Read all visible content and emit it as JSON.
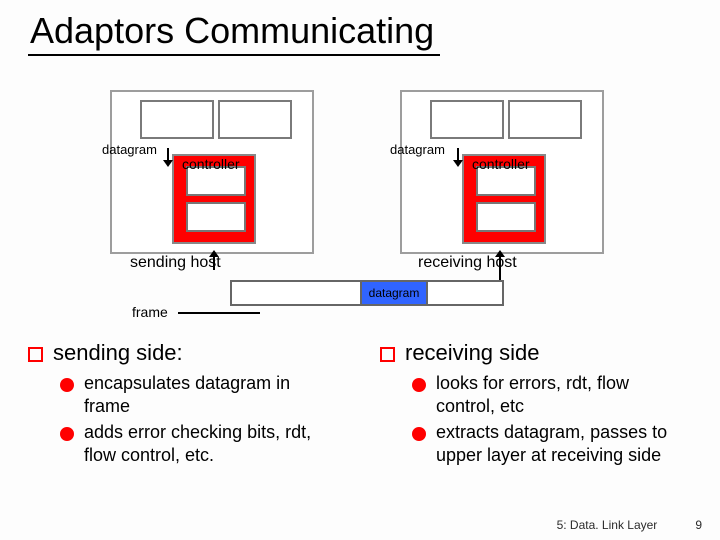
{
  "title": "Adaptors Communicating",
  "diagram": {
    "datagram_label": "datagram",
    "controller_label": "controller",
    "sending_host": "sending host",
    "receiving_host": "receiving host",
    "frame_datagram": "datagram",
    "frame_label": "frame"
  },
  "left": {
    "heading": "sending side:",
    "b1": "encapsulates datagram in frame",
    "b2": "adds error checking bits, rdt, flow control, etc."
  },
  "right": {
    "heading": "receiving side",
    "b1": "looks for errors, rdt, flow control, etc",
    "b2": "extracts datagram, passes to upper layer at receiving side"
  },
  "footer": {
    "section": "5: Data. Link Layer",
    "page": "9"
  }
}
